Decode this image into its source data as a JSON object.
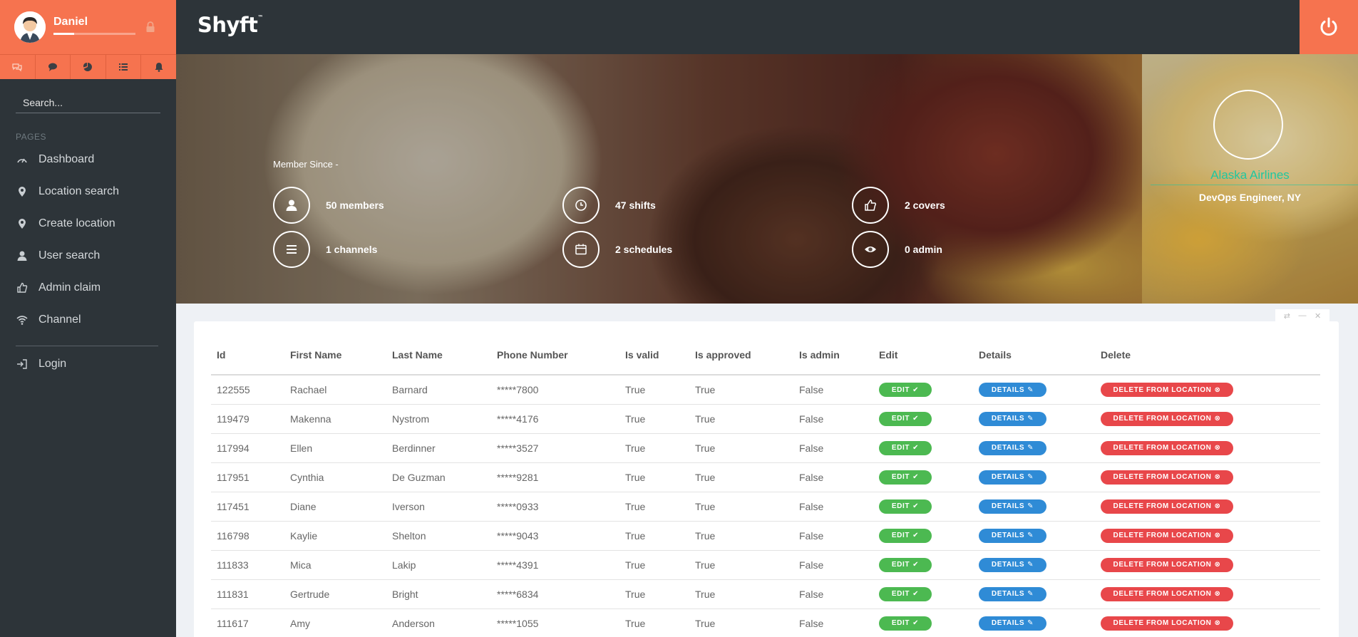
{
  "user": {
    "name": "Daniel",
    "progress_fraction": 0.25
  },
  "sidebar": {
    "search_placeholder": "Search...",
    "pages_heading": "PAGES",
    "items": [
      {
        "label": "Dashboard",
        "icon": "speedometer-icon"
      },
      {
        "label": "Location search",
        "icon": "map-pin-icon"
      },
      {
        "label": "Create location",
        "icon": "map-pin-icon"
      },
      {
        "label": "User search",
        "icon": "user-icon"
      },
      {
        "label": "Admin claim",
        "icon": "thumbs-up-icon"
      },
      {
        "label": "Channel",
        "icon": "wifi-icon"
      }
    ],
    "login_label": "Login"
  },
  "topbar": {
    "brand": "Shyft",
    "brand_tm": "™"
  },
  "hero": {
    "member_since": "Member Since -",
    "stats": [
      {
        "label": "50 members",
        "icon": "user-icon"
      },
      {
        "label": "47 shifts",
        "icon": "clock-icon"
      },
      {
        "label": "2 covers",
        "icon": "thumbs-up-icon"
      },
      {
        "label": "1 channels",
        "icon": "list-icon"
      },
      {
        "label": "2 schedules",
        "icon": "calendar-icon"
      },
      {
        "label": "0 admin",
        "icon": "eye-icon"
      }
    ]
  },
  "profile": {
    "company": "Alaska Airlines",
    "role": "DevOps Engineer, NY"
  },
  "table": {
    "headers": [
      "Id",
      "First Name",
      "Last Name",
      "Phone Number",
      "Is valid",
      "Is approved",
      "Is admin",
      "Edit",
      "Details",
      "Delete"
    ],
    "buttons": {
      "edit": "EDIT",
      "details": "DETAILS",
      "delete": "DELETE FROM LOCATION"
    },
    "rows": [
      {
        "id": "122555",
        "first": "Rachael",
        "last": "Barnard",
        "phone": "*****7800",
        "valid": "True",
        "approved": "True",
        "admin": "False"
      },
      {
        "id": "119479",
        "first": "Makenna",
        "last": "Nystrom",
        "phone": "*****4176",
        "valid": "True",
        "approved": "True",
        "admin": "False"
      },
      {
        "id": "117994",
        "first": "Ellen",
        "last": "Berdinner",
        "phone": "*****3527",
        "valid": "True",
        "approved": "True",
        "admin": "False"
      },
      {
        "id": "117951",
        "first": "Cynthia",
        "last": "De Guzman",
        "phone": "*****9281",
        "valid": "True",
        "approved": "True",
        "admin": "False"
      },
      {
        "id": "117451",
        "first": "Diane",
        "last": "Iverson",
        "phone": "*****0933",
        "valid": "True",
        "approved": "True",
        "admin": "False"
      },
      {
        "id": "116798",
        "first": "Kaylie",
        "last": "Shelton",
        "phone": "*****9043",
        "valid": "True",
        "approved": "True",
        "admin": "False"
      },
      {
        "id": "111833",
        "first": "Mica",
        "last": "Lakip",
        "phone": "*****4391",
        "valid": "True",
        "approved": "True",
        "admin": "False"
      },
      {
        "id": "111831",
        "first": "Gertrude",
        "last": "Bright",
        "phone": "*****6834",
        "valid": "True",
        "approved": "True",
        "admin": "False"
      },
      {
        "id": "111617",
        "first": "Amy",
        "last": "Anderson",
        "phone": "*****1055",
        "valid": "True",
        "approved": "True",
        "admin": "False"
      }
    ]
  },
  "colors": {
    "accent": "#f6734f",
    "sidebar_bg": "#2d3439",
    "edit": "#4cb951",
    "details": "#2f8bd6",
    "delete": "#e8474a",
    "company": "#1fc7a0"
  }
}
